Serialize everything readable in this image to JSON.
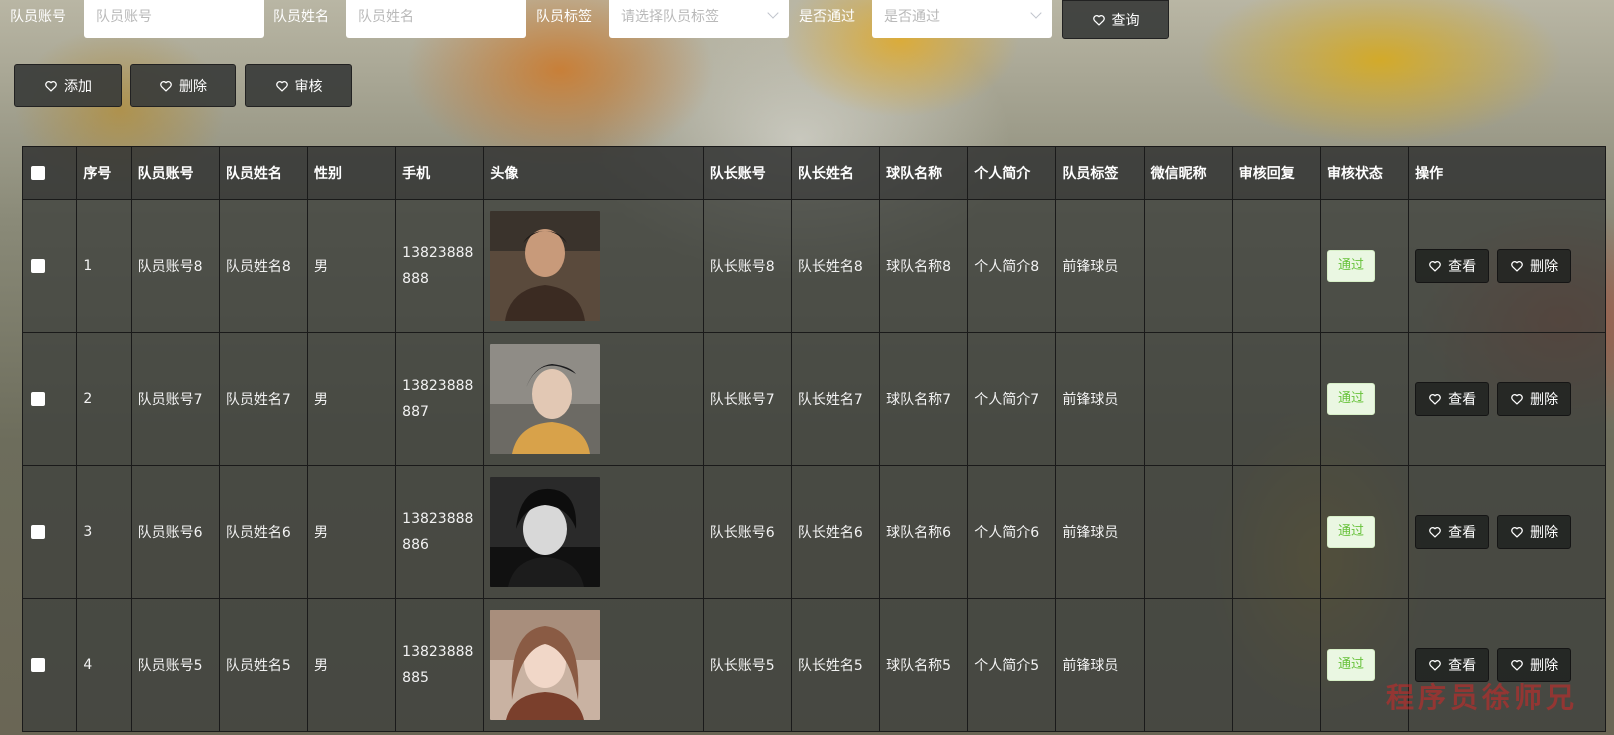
{
  "search": {
    "account_label": "队员账号",
    "account_placeholder": "队员账号",
    "name_label": "队员姓名",
    "name_placeholder": "队员姓名",
    "tag_label": "队员标签",
    "tag_placeholder": "请选择队员标签",
    "passed_label": "是否通过",
    "passed_placeholder": "是否通过",
    "query_button": "查询"
  },
  "toolbar": {
    "add": "添加",
    "delete": "删除",
    "review": "审核"
  },
  "table": {
    "headers": [
      "序号",
      "队员账号",
      "队员姓名",
      "性别",
      "手机",
      "头像",
      "队长账号",
      "队长姓名",
      "球队名称",
      "个人简介",
      "队员标签",
      "微信昵称",
      "审核回复",
      "审核状态",
      "操作"
    ],
    "rows": [
      {
        "index": "1",
        "account": "队员账号8",
        "name": "队员姓名8",
        "gender": "男",
        "phone": "13823888888",
        "captain_account": "队长账号8",
        "captain_name": "队长姓名8",
        "team": "球队名称8",
        "intro": "个人简介8",
        "tag": "前锋球员",
        "wechat": "",
        "reply": "",
        "status": "通过",
        "view": "查看",
        "delete": "删除"
      },
      {
        "index": "2",
        "account": "队员账号7",
        "name": "队员姓名7",
        "gender": "男",
        "phone": "13823888887",
        "captain_account": "队长账号7",
        "captain_name": "队长姓名7",
        "team": "球队名称7",
        "intro": "个人简介7",
        "tag": "前锋球员",
        "wechat": "",
        "reply": "",
        "status": "通过",
        "view": "查看",
        "delete": "删除"
      },
      {
        "index": "3",
        "account": "队员账号6",
        "name": "队员姓名6",
        "gender": "男",
        "phone": "13823888886",
        "captain_account": "队长账号6",
        "captain_name": "队长姓名6",
        "team": "球队名称6",
        "intro": "个人简介6",
        "tag": "前锋球员",
        "wechat": "",
        "reply": "",
        "status": "通过",
        "view": "查看",
        "delete": "删除"
      },
      {
        "index": "4",
        "account": "队员账号5",
        "name": "队员姓名5",
        "gender": "男",
        "phone": "13823888885",
        "captain_account": "队长账号5",
        "captain_name": "队长姓名5",
        "team": "球队名称5",
        "intro": "个人简介5",
        "tag": "前锋球员",
        "wechat": "",
        "reply": "",
        "status": "通过",
        "view": "查看",
        "delete": "删除"
      }
    ]
  },
  "watermark": "程序员徐师兄",
  "icons": {
    "button_icon": "heart-icon",
    "select_icon": "chevron-down-icon"
  },
  "colors": {
    "status_pass_bg": "#eaf7e2",
    "status_pass_text": "#67c23a"
  }
}
